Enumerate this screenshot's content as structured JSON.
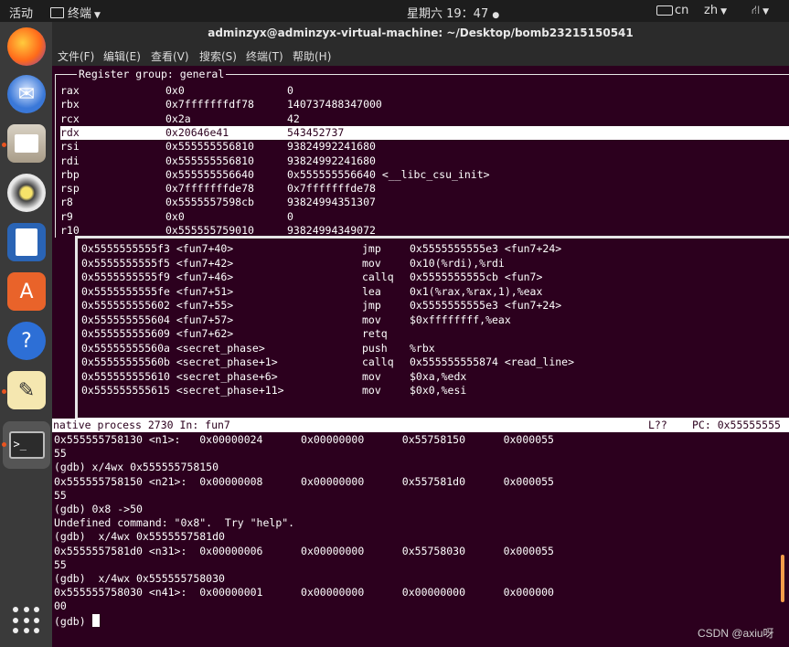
{
  "topbar": {
    "activities": "活动",
    "app_name": "终端",
    "clock": "星期六 19：47",
    "input_method": "cn",
    "language": "zh"
  },
  "window": {
    "title": "adminzyx@adminzyx-virtual-machine: ~/Desktop/bomb23215150541"
  },
  "menu": [
    "文件(F)",
    "编辑(E)",
    "查看(V)",
    "搜索(S)",
    "终端(T)",
    "帮助(H)"
  ],
  "registers": {
    "title": "Register group: general",
    "rows": [
      {
        "name": "rax",
        "hex": "0x0",
        "val": "0"
      },
      {
        "name": "rbx",
        "hex": "0x7fffffffdf78",
        "val": "140737488347000"
      },
      {
        "name": "rcx",
        "hex": "0x2a",
        "val": "42"
      },
      {
        "name": "rdx",
        "hex": "0x20646e41",
        "val": "543452737"
      },
      {
        "name": "rsi",
        "hex": "0x555555556810",
        "val": "93824992241680"
      },
      {
        "name": "rdi",
        "hex": "0x555555556810",
        "val": "93824992241680"
      },
      {
        "name": "rbp",
        "hex": "0x555555556640",
        "val": "0x555555556640 <__libc_csu_init>"
      },
      {
        "name": "rsp",
        "hex": "0x7fffffffde78",
        "val": "0x7fffffffde78"
      },
      {
        "name": "r8",
        "hex": "0x5555557598cb",
        "val": "93824994351307"
      },
      {
        "name": "r9",
        "hex": "0x0",
        "val": "0"
      },
      {
        "name": "r10",
        "hex": "0x555555759010",
        "val": "93824994349072"
      }
    ],
    "highlighted": "rdx"
  },
  "asm": [
    {
      "addr": "0x5555555555f3 <fun7+40>",
      "op": "jmp",
      "args": "0x5555555555e3 <fun7+24>"
    },
    {
      "addr": "0x5555555555f5 <fun7+42>",
      "op": "mov",
      "args": "0x10(%rdi),%rdi"
    },
    {
      "addr": "0x5555555555f9 <fun7+46>",
      "op": "callq",
      "args": "0x5555555555cb <fun7>"
    },
    {
      "addr": "0x5555555555fe <fun7+51>",
      "op": "lea",
      "args": "0x1(%rax,%rax,1),%eax"
    },
    {
      "addr": "0x555555555602 <fun7+55>",
      "op": "jmp",
      "args": "0x5555555555e3 <fun7+24>"
    },
    {
      "addr": "0x555555555604 <fun7+57>",
      "op": "mov",
      "args": "$0xffffffff,%eax"
    },
    {
      "addr": "0x555555555609 <fun7+62>",
      "op": "retq",
      "args": ""
    },
    {
      "addr": "0x55555555560a <secret_phase>",
      "op": "push",
      "args": "%rbx"
    },
    {
      "addr": "0x55555555560b <secret_phase+1>",
      "op": "callq",
      "args": "0x555555555874 <read_line>"
    },
    {
      "addr": "0x555555555610 <secret_phase+6>",
      "op": "mov",
      "args": "$0xa,%edx"
    },
    {
      "addr": "0x555555555615 <secret_phase+11>",
      "op": "mov",
      "args": "$0x0,%esi"
    }
  ],
  "status": {
    "left": "native process 2730 In: fun7",
    "line": "L??",
    "pc": "PC: 0x55555555"
  },
  "console": [
    "0x555555758130 <n1>:   0x00000024      0x00000000      0x55758150      0x000055",
    "55",
    "(gdb) x/4wx 0x555555758150",
    "0x555555758150 <n21>:  0x00000008      0x00000000      0x557581d0      0x000055",
    "55",
    "(gdb) 0x8 ->50",
    "Undefined command: \"0x8\".  Try \"help\".",
    "(gdb)  x/4wx 0x5555557581d0",
    "0x5555557581d0 <n31>:  0x00000006      0x00000000      0x55758030      0x000055",
    "55",
    "(gdb)  x/4wx 0x555555758030",
    "0x555555758030 <n41>:  0x00000001      0x00000000      0x00000000      0x000000",
    "00"
  ],
  "prompt": "(gdb) ",
  "watermark": "CSDN @axiu呀",
  "dock": [
    "firefox-icon",
    "thunderbird-icon",
    "files-icon",
    "rhythmbox-icon",
    "libreoffice-writer-icon",
    "software-center-icon",
    "help-icon",
    "text-editor-icon",
    "terminal-icon"
  ]
}
